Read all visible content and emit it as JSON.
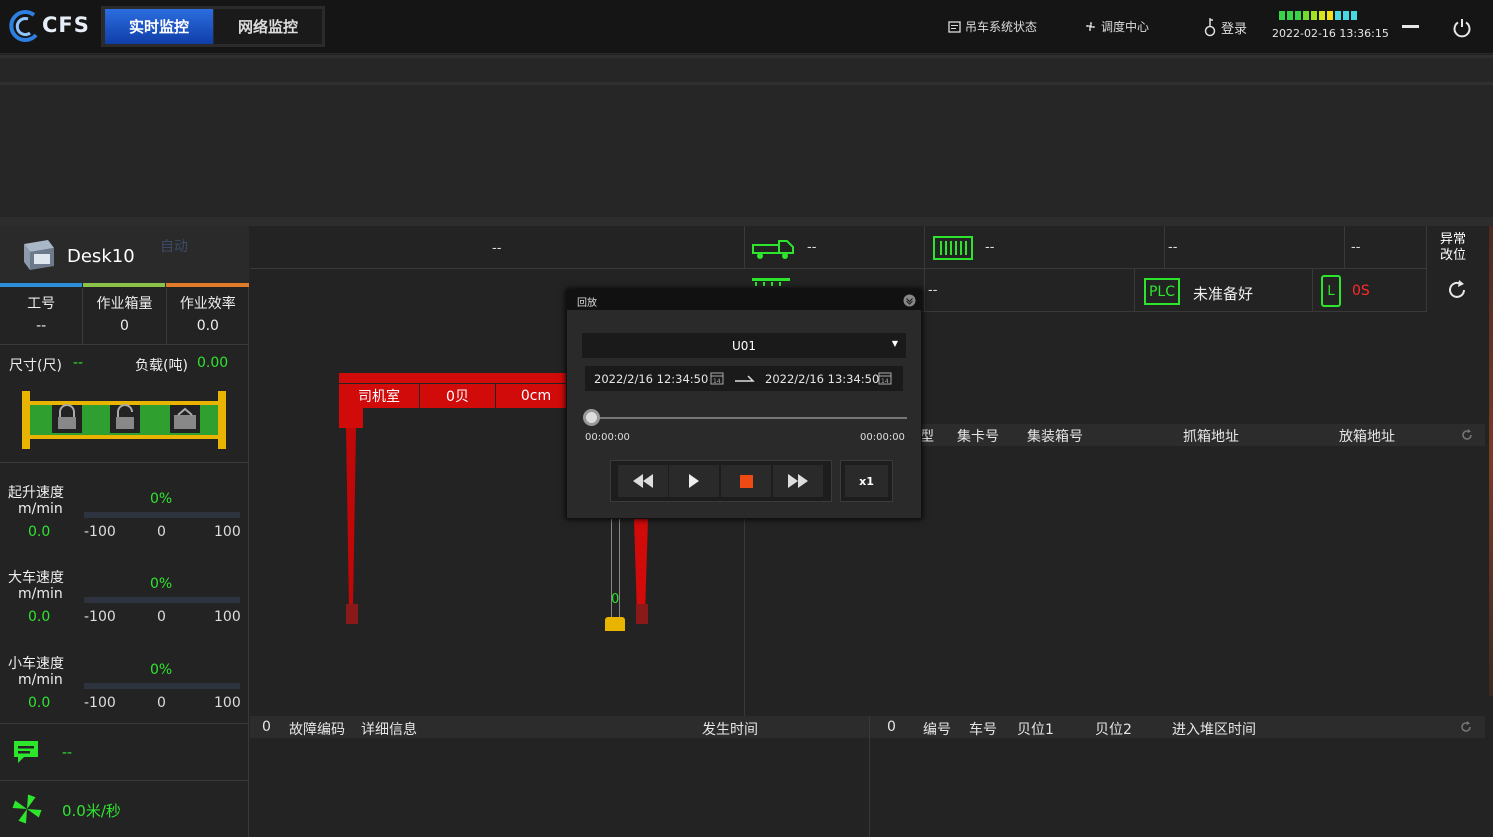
{
  "app": {
    "logo": "CFS",
    "tabs": [
      {
        "label": "实时监控",
        "active": true
      },
      {
        "label": "网络监控",
        "active": false
      }
    ],
    "top_items": [
      {
        "label": "吊车系统状态",
        "icon": "window-icon"
      },
      {
        "label": "调度中心",
        "icon": "fan-icon"
      },
      {
        "label": "登录",
        "icon": "key-icon"
      }
    ],
    "datetime": "2022-02-16 13:36:15",
    "signal_colors": [
      "#39d34a",
      "#39d34a",
      "#39d34a",
      "#6fdc2f",
      "#a2e21f",
      "#d8e51c",
      "#f3e11a",
      "#46d9e0",
      "#46d9e0",
      "#46d9e0"
    ]
  },
  "left": {
    "desk_name": "Desk10",
    "mode_watermark": "自动",
    "stats": [
      {
        "label": "工号",
        "value": "--"
      },
      {
        "label": "作业箱量",
        "value": "0"
      },
      {
        "label": "作业效率",
        "value": "0.0"
      }
    ],
    "size_label": "尺寸(尺)",
    "size_value": "--",
    "load_label": "负载(吨)",
    "load_value": "0.00",
    "speeds": [
      {
        "label": "起升速度",
        "unit": "m/min",
        "percent": "0%",
        "value": "0.0",
        "min": "-100",
        "mid": "0",
        "max": "100"
      },
      {
        "label": "大车速度",
        "unit": "m/min",
        "percent": "0%",
        "value": "0.0",
        "min": "-100",
        "mid": "0",
        "max": "100"
      },
      {
        "label": "小车速度",
        "unit": "m/min",
        "percent": "0%",
        "value": "0.0",
        "min": "-100",
        "mid": "0",
        "max": "100"
      }
    ],
    "message_value": "--",
    "wind_value": "0.0米/秒"
  },
  "center": {
    "status_top": "--",
    "truck_value": "--",
    "container_value": "--",
    "col3_value": "--",
    "col4_value": "--",
    "abnormal_label": "异常改位",
    "row2_value": "--",
    "plc_label": "PLC",
    "plc_status": "未准备好",
    "l_badge": "L",
    "time_value": "0S",
    "crane": {
      "cab": "司机室",
      "bay": "0贝",
      "pos": "0cm",
      "hoist_value": "0"
    }
  },
  "job_table": {
    "headers": [
      "型",
      "集卡号",
      "集装箱号",
      "抓箱地址",
      "放箱地址"
    ]
  },
  "fault_table": {
    "count": "0",
    "headers": [
      "故障编码",
      "详细信息",
      "发生时间"
    ]
  },
  "yard_table": {
    "count": "0",
    "headers": [
      "编号",
      "车号",
      "贝位1",
      "贝位2",
      "进入堆区时间"
    ]
  },
  "dialog": {
    "title": "回放",
    "device": "U01",
    "start": "2022/2/16 12:34:50",
    "end": "2022/2/16 13:34:50",
    "elapsed": "00:00:00",
    "total": "00:00:00",
    "speed": "x1"
  }
}
